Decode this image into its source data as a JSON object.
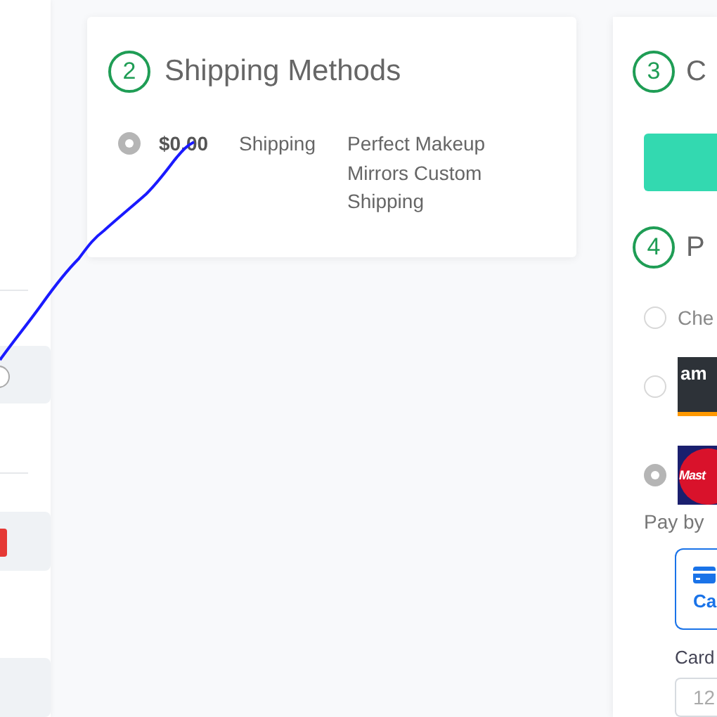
{
  "shipping": {
    "step": "2",
    "title": "Shipping Methods",
    "methods": [
      {
        "price": "$0.00",
        "carrier": "Shipping",
        "description": "Perfect Makeup Mirrors Custom Shipping",
        "selected": true
      }
    ]
  },
  "checkout": {
    "step": "3",
    "title": "C"
  },
  "payment": {
    "step": "4",
    "title": "P",
    "methods": [
      {
        "kind": "text",
        "label": "Che",
        "selected": false
      },
      {
        "kind": "amazon",
        "label": "am",
        "selected": false
      },
      {
        "kind": "mastercard",
        "label": "Mast",
        "selected": true
      }
    ],
    "pay_by_label": "Pay by",
    "options": [
      {
        "label": "Ca",
        "selected": true
      }
    ],
    "card_label": "Card",
    "card_placeholder": "12"
  }
}
